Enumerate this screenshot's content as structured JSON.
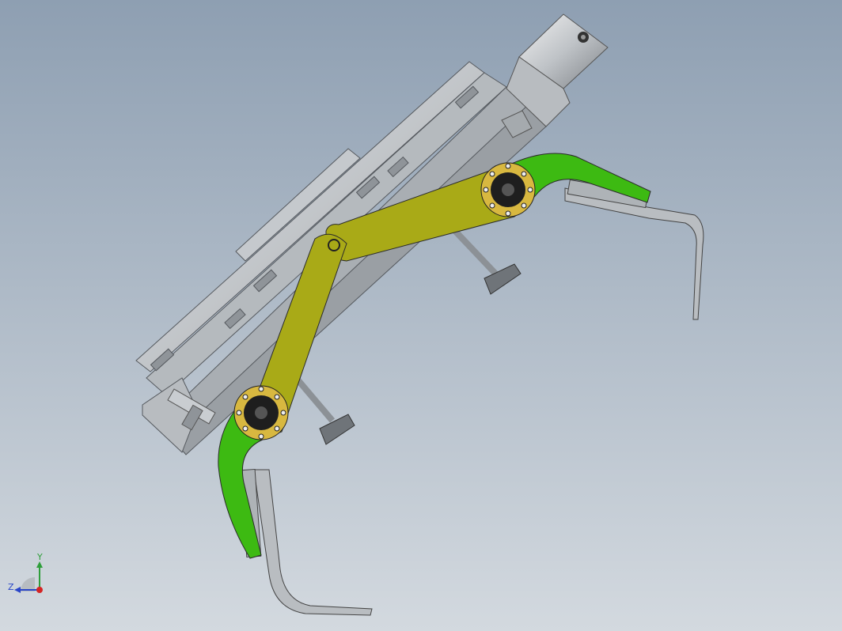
{
  "triad": {
    "y_label": "Y",
    "z_label": "Z",
    "colors": {
      "y": "#2e9e3a",
      "z": "#2a46c8",
      "x": "#d42424"
    }
  },
  "colors": {
    "background_top": "#8e9fb2",
    "background_bottom": "#d2d8df",
    "link_yellow": "#a9aa17",
    "jaw_green": "#3dba12",
    "rail_silver": "#c8ccd0",
    "hub_dark": "#1e1e1e",
    "hub_gold": "#d8b840"
  }
}
